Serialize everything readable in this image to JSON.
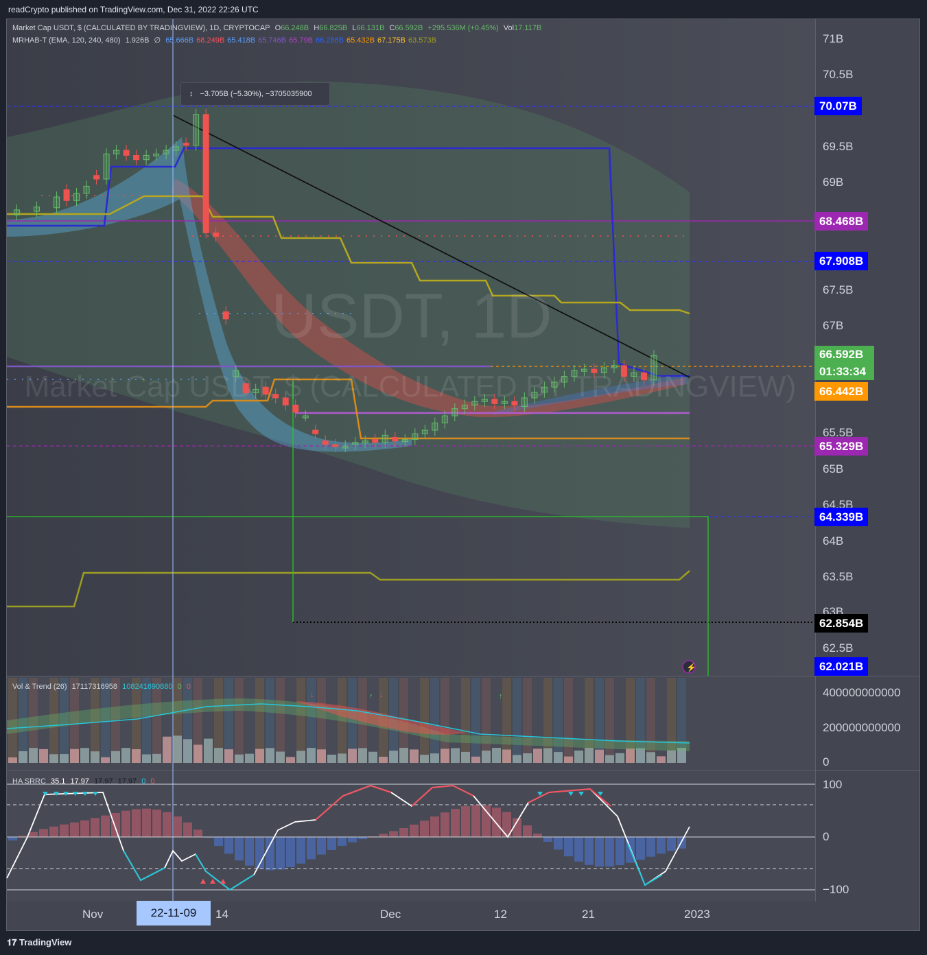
{
  "header": {
    "published": "readCrypto published on TradingView.com, Dec 31, 2022 22:26 UTC"
  },
  "footer": {
    "brand": "TradingView"
  },
  "main_legend": {
    "symbol": "Market Cap USDT, $ (CALCULATED BY TRADINGVIEW), 1D, CRYPTOCAP",
    "ohlc": [
      {
        "label": "O",
        "value": "66.248B"
      },
      {
        "label": "H",
        "value": "66.825B"
      },
      {
        "label": "L",
        "value": "66.131B"
      },
      {
        "label": "C",
        "value": "66.592B"
      }
    ],
    "change": "+295.536M (+0.45%)",
    "vol_label": "Vol",
    "vol": "17.117B"
  },
  "indicator_legend": {
    "name": "MRHAB-T (EMA, 120, 240, 480)",
    "base": "1.926B",
    "sym": "∅",
    "values": [
      {
        "v": "65.666B",
        "color": "#5b9cf6"
      },
      {
        "v": "68.249B",
        "color": "#f7525f"
      },
      {
        "v": "65.418B",
        "color": "#5b9cf6"
      },
      {
        "v": "65.746B",
        "color": "#7e57c2"
      },
      {
        "v": "65.79B",
        "color": "#ab47bc"
      },
      {
        "v": "66.286B",
        "color": "#2962ff"
      },
      {
        "v": "65.432B",
        "color": "#ff9800"
      },
      {
        "v": "67.175B",
        "color": "#fbc02d"
      },
      {
        "v": "63.573B",
        "color": "#9e9d24"
      }
    ]
  },
  "tooltip": {
    "text": "−3.705B (−5.30%), −3705035900"
  },
  "watermark": {
    "big": "USDT, 1D",
    "sub": "Market Cap USDT, $ (CALCULATED BY TRADINGVIEW)"
  },
  "price_axis": {
    "ticks": [
      "71B",
      "70.5B",
      "69.5B",
      "69B",
      "67.5B",
      "67B",
      "65.5B",
      "65B",
      "64.5B",
      "64B",
      "63.5B",
      "63B",
      "62.5B"
    ],
    "boxes": [
      {
        "label": "70.07B",
        "color": "#0000ff"
      },
      {
        "label": "68.468B",
        "color": "#9c27b0"
      },
      {
        "label": "67.908B",
        "color": "#0000ff"
      },
      {
        "label": "66.592B",
        "color": "#4caf50"
      },
      {
        "label": "01:33:34",
        "color": "#4caf50"
      },
      {
        "label": "66.442B",
        "color": "#ff9800"
      },
      {
        "label": "65.329B",
        "color": "#9c27b0"
      },
      {
        "label": "64.339B",
        "color": "#0000ff"
      },
      {
        "label": "62.854B",
        "color": "#000000"
      },
      {
        "label": "62.021B",
        "color": "#0000ff"
      }
    ]
  },
  "time_axis": {
    "labels": [
      "Nov",
      "14",
      "Dec",
      "12",
      "21",
      "2023"
    ],
    "cursor": "22-11-09"
  },
  "vol_pane": {
    "legend_name": "Vol & Trend (26)",
    "v1": "17117316958",
    "v2": "108241690880",
    "v3": "0",
    "v4": "0",
    "ticks": [
      "400000000000",
      "200000000000",
      "0"
    ]
  },
  "srrc_pane": {
    "legend_name": "HA SRRC",
    "values": [
      "35.1",
      "17.97",
      "17.97",
      "17.97",
      "0",
      "0"
    ],
    "ticks": [
      "100",
      "0",
      "−100"
    ]
  },
  "chart_data": {
    "type": "candlestick",
    "title": "Market Cap USDT, $ (CALCULATED BY TRADINGVIEW), 1D, CRYPTOCAP",
    "ylim": [
      61.9,
      71.4
    ],
    "x_range": [
      "2022-10-27",
      "2023-01-06"
    ],
    "last_close": 66.592,
    "close": [
      {
        "date": "2022-10-28",
        "o": 68.55,
        "c": 68.62
      },
      {
        "date": "2022-10-30",
        "o": 68.6,
        "c": 68.66
      },
      {
        "date": "2022-11-01",
        "o": 68.65,
        "c": 68.8
      },
      {
        "date": "2022-11-02",
        "o": 68.9,
        "c": 68.75
      },
      {
        "date": "2022-11-03",
        "o": 68.75,
        "c": 68.85
      },
      {
        "date": "2022-11-04",
        "o": 68.85,
        "c": 68.95
      },
      {
        "date": "2022-11-05",
        "o": 69.1,
        "c": 69.05
      },
      {
        "date": "2022-11-06",
        "o": 69.05,
        "c": 69.4
      },
      {
        "date": "2022-11-07",
        "o": 69.4,
        "c": 69.45
      },
      {
        "date": "2022-11-08",
        "o": 69.45,
        "c": 69.38
      },
      {
        "date": "2022-11-09",
        "o": 69.38,
        "c": 69.32
      },
      {
        "date": "2022-11-10",
        "o": 69.32,
        "c": 69.38
      },
      {
        "date": "2022-11-11",
        "o": 69.38,
        "c": 69.4
      },
      {
        "date": "2022-11-12",
        "o": 69.4,
        "c": 69.45
      },
      {
        "date": "2022-11-13",
        "o": 69.45,
        "c": 69.5
      },
      {
        "date": "2022-11-14",
        "o": 69.55,
        "c": 69.52
      },
      {
        "date": "2022-11-15",
        "o": 69.52,
        "c": 69.95
      },
      {
        "date": "2022-11-16",
        "o": 69.95,
        "c": 68.3
      },
      {
        "date": "2022-11-17",
        "o": 68.3,
        "c": 68.25
      },
      {
        "date": "2022-11-18",
        "o": 67.2,
        "c": 67.1
      },
      {
        "date": "2022-11-19",
        "o": 66.3,
        "c": 66.38
      },
      {
        "date": "2022-11-20",
        "o": 66.2,
        "c": 66.07
      },
      {
        "date": "2022-11-21",
        "o": 66.07,
        "c": 66.12
      },
      {
        "date": "2022-11-22",
        "o": 66.15,
        "c": 66.05
      },
      {
        "date": "2022-11-23",
        "o": 66.05,
        "c": 66.0
      },
      {
        "date": "2022-11-24",
        "o": 66.0,
        "c": 65.9
      },
      {
        "date": "2022-11-25",
        "o": 65.9,
        "c": 65.8
      },
      {
        "date": "2022-11-26",
        "o": 65.75,
        "c": 65.75
      },
      {
        "date": "2022-11-27",
        "o": 65.55,
        "c": 65.5
      },
      {
        "date": "2022-11-28",
        "o": 65.4,
        "c": 65.35
      },
      {
        "date": "2022-11-29",
        "o": 65.35,
        "c": 65.32
      },
      {
        "date": "2022-11-30",
        "o": 65.32,
        "c": 65.33
      },
      {
        "date": "2022-12-01",
        "o": 65.35,
        "c": 65.38
      },
      {
        "date": "2022-12-02",
        "o": 65.38,
        "c": 65.4
      },
      {
        "date": "2022-12-03",
        "o": 65.42,
        "c": 65.38
      },
      {
        "date": "2022-12-04",
        "o": 65.38,
        "c": 65.48
      },
      {
        "date": "2022-12-05",
        "o": 65.45,
        "c": 65.4
      },
      {
        "date": "2022-12-06",
        "o": 65.4,
        "c": 65.42
      },
      {
        "date": "2022-12-07",
        "o": 65.42,
        "c": 65.5
      },
      {
        "date": "2022-12-08",
        "o": 65.5,
        "c": 65.55
      },
      {
        "date": "2022-12-09",
        "o": 65.55,
        "c": 65.65
      },
      {
        "date": "2022-12-10",
        "o": 65.65,
        "c": 65.75
      },
      {
        "date": "2022-12-11",
        "o": 65.75,
        "c": 65.85
      },
      {
        "date": "2022-12-12",
        "o": 65.85,
        "c": 65.9
      },
      {
        "date": "2022-12-13",
        "o": 65.9,
        "c": 65.95
      },
      {
        "date": "2022-12-14",
        "o": 65.95,
        "c": 65.98
      },
      {
        "date": "2022-12-15",
        "o": 65.98,
        "c": 65.92
      },
      {
        "date": "2022-12-16",
        "o": 65.92,
        "c": 65.95
      },
      {
        "date": "2022-12-17",
        "o": 65.95,
        "c": 65.9
      },
      {
        "date": "2022-12-18",
        "o": 65.88,
        "c": 66.0
      },
      {
        "date": "2022-12-19",
        "o": 66.0,
        "c": 66.08
      },
      {
        "date": "2022-12-20",
        "o": 66.08,
        "c": 66.15
      },
      {
        "date": "2022-12-21",
        "o": 66.15,
        "c": 66.22
      },
      {
        "date": "2022-12-22",
        "o": 66.22,
        "c": 66.3
      },
      {
        "date": "2022-12-23",
        "o": 66.3,
        "c": 66.38
      },
      {
        "date": "2022-12-24",
        "o": 66.38,
        "c": 66.4
      },
      {
        "date": "2022-12-25",
        "o": 66.4,
        "c": 66.35
      },
      {
        "date": "2022-12-26",
        "o": 66.35,
        "c": 66.42
      },
      {
        "date": "2022-12-27",
        "o": 66.42,
        "c": 66.45
      },
      {
        "date": "2022-12-28",
        "o": 66.45,
        "c": 66.3
      },
      {
        "date": "2022-12-29",
        "o": 66.3,
        "c": 66.35
      },
      {
        "date": "2022-12-30",
        "o": 66.35,
        "c": 66.25
      },
      {
        "date": "2022-12-31",
        "o": 66.25,
        "c": 66.59
      }
    ]
  },
  "colors": {
    "up": "#66bb6a",
    "down": "#ef5350",
    "blue_line": "#2a2ad0",
    "olive_line": "#b5a81e",
    "orange_line": "#d68b1c",
    "purple_line": "#9c27b0",
    "green_box": "#26c826"
  }
}
